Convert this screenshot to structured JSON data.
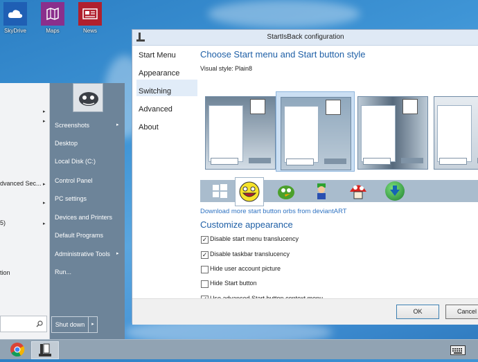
{
  "desktop_icons": [
    {
      "label": "SkyDrive",
      "icon": "cloud-icon",
      "color": "#1f5fb4"
    },
    {
      "label": "Maps",
      "icon": "maps-icon",
      "color": "#8a2f8c"
    },
    {
      "label": "News",
      "icon": "news-icon",
      "color": "#b0202e"
    }
  ],
  "start_menu": {
    "left_items": [
      {
        "label": "",
        "has_arrow": true
      },
      {
        "label": "",
        "has_arrow": true
      },
      {
        "label": "dvanced Sec...",
        "has_arrow": true
      },
      {
        "label": "",
        "has_arrow": true
      },
      {
        "label": "5)",
        "has_arrow": true
      },
      {
        "label": "tion",
        "has_arrow": false
      }
    ],
    "right_items": [
      {
        "label": "Screenshots",
        "has_arrow": true
      },
      {
        "label": "Desktop",
        "has_arrow": false
      },
      {
        "label": "Local Disk (C:)",
        "has_arrow": false
      },
      {
        "label": "Control Panel",
        "has_arrow": false
      },
      {
        "label": "PC settings",
        "has_arrow": false
      },
      {
        "label": "Devices and Printers",
        "has_arrow": false
      },
      {
        "label": "Default Programs",
        "has_arrow": false
      },
      {
        "label": "Administrative Tools",
        "has_arrow": true
      },
      {
        "label": "Run...",
        "has_arrow": false
      }
    ],
    "shutdown_label": "Shut down"
  },
  "dialog": {
    "title": "StartIsBack configuration",
    "nav": [
      "Start Menu",
      "Appearance",
      "Switching",
      "Advanced",
      "About"
    ],
    "selected_nav": "Appearance",
    "heading_style": "Choose Start menu and Start button style",
    "visual_style_label": "Visual style:",
    "visual_style_value": "Plain8",
    "download_link": "Download more start button orbs from deviantART",
    "heading_customize": "Customize appearance",
    "checkboxes": [
      {
        "label": "Disable start menu translucency",
        "checked": true
      },
      {
        "label": "Disable taskbar translucency",
        "checked": true
      },
      {
        "label": "Hide user account picture",
        "checked": false
      },
      {
        "label": "Hide Start button",
        "checked": false
      },
      {
        "label": "Use advanced Start button context menu",
        "checked": true
      }
    ],
    "ok_label": "OK",
    "cancel_label": "Cancel"
  },
  "colors": {
    "accent_heading": "#1e5fa6",
    "selection": "#e1ecf8",
    "start_menu_right": "#6d8499",
    "taskbar": "#91a3b3"
  }
}
